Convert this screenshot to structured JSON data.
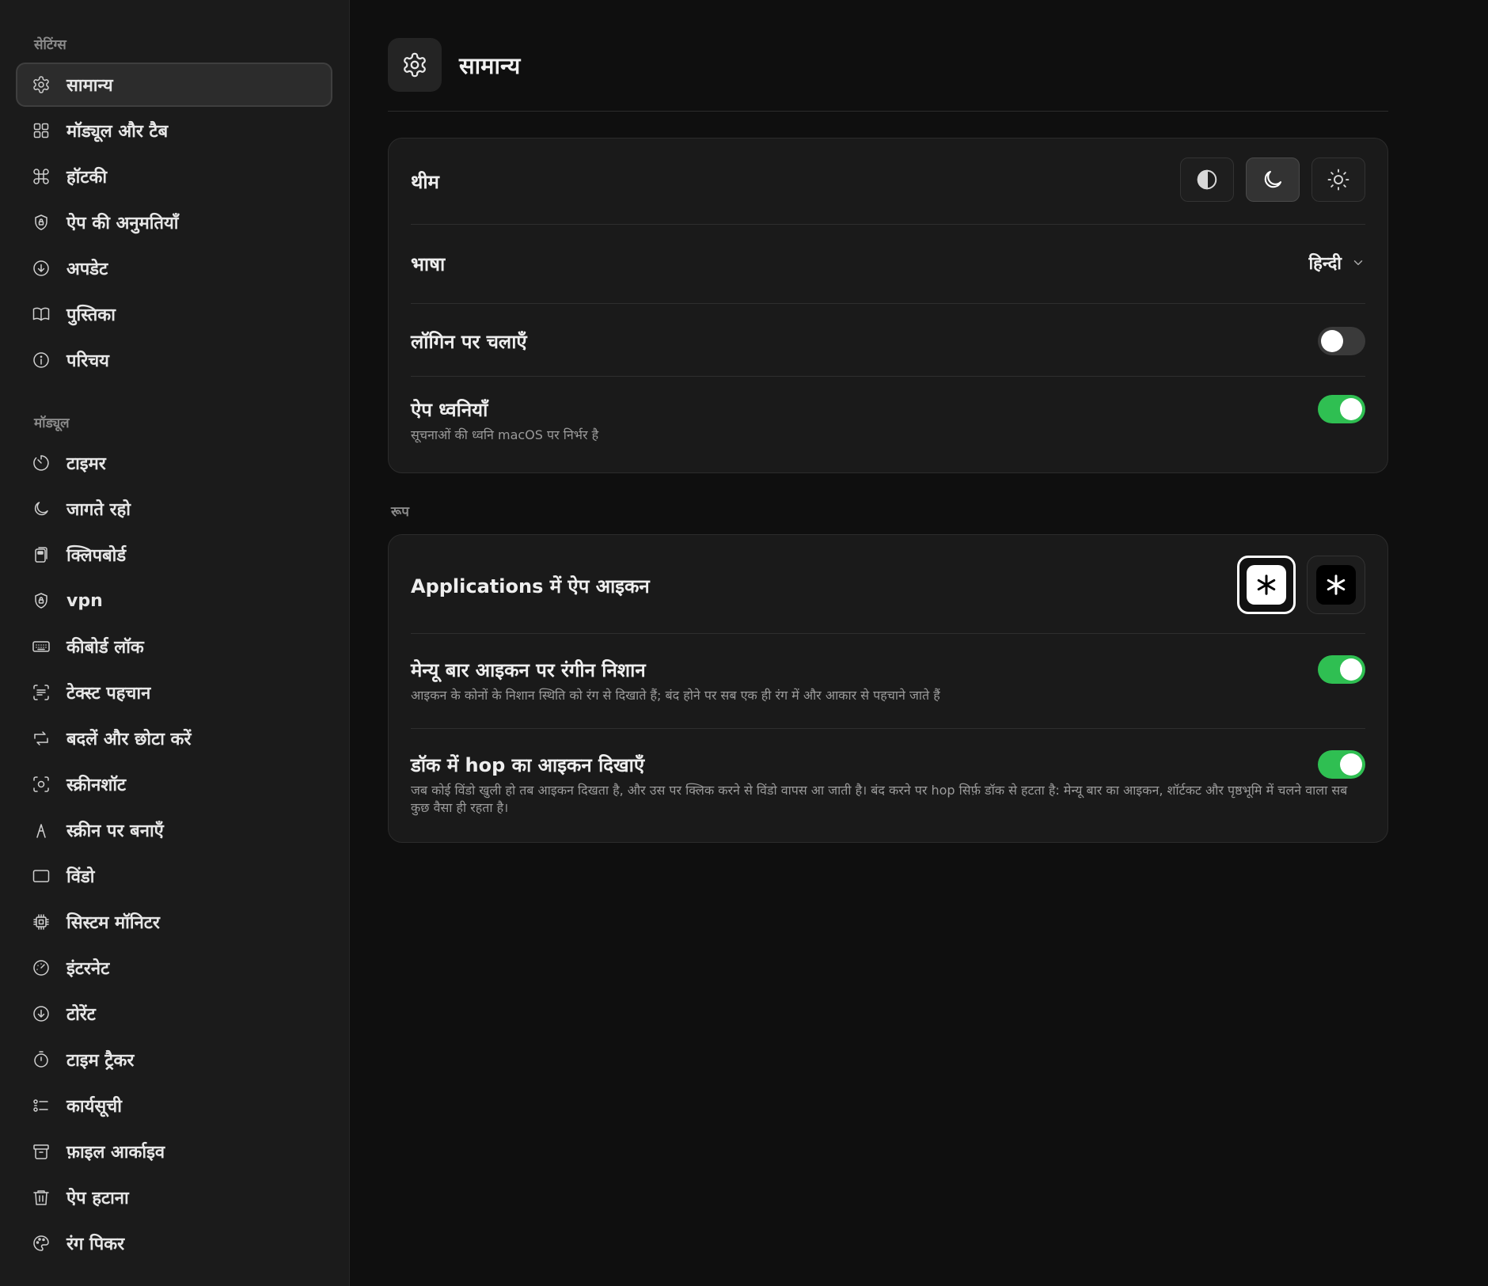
{
  "sidebar": {
    "settings_heading": "सेटिंग्स",
    "settings_items": [
      {
        "label": "सामान्य",
        "icon": "gear-icon",
        "active": true
      },
      {
        "label": "मॉड्यूल और टैब",
        "icon": "grid-icon"
      },
      {
        "label": "हॉटकी",
        "icon": "command-icon"
      },
      {
        "label": "ऐप की अनुमतियाँ",
        "icon": "shield-lock-icon"
      },
      {
        "label": "अपडेट",
        "icon": "download-circle-icon"
      },
      {
        "label": "पुस्तिका",
        "icon": "book-icon"
      },
      {
        "label": "परिचय",
        "icon": "info-icon"
      }
    ],
    "modules_heading": "मॉड्यूल",
    "module_items": [
      {
        "label": "टाइमर",
        "icon": "timer-icon"
      },
      {
        "label": "जागते रहो",
        "icon": "moon-icon"
      },
      {
        "label": "क्लिपबोर्ड",
        "icon": "clipboard-icon"
      },
      {
        "label": "vpn",
        "icon": "shield-lock-icon"
      },
      {
        "label": "कीबोर्ड लॉक",
        "icon": "keyboard-icon"
      },
      {
        "label": "टेक्स्ट पहचान",
        "icon": "text-scan-icon"
      },
      {
        "label": "बदलें और छोटा करें",
        "icon": "convert-icon"
      },
      {
        "label": "स्क्रीनशॉट",
        "icon": "screenshot-icon"
      },
      {
        "label": "स्क्रीन पर बनाएँ",
        "icon": "pen-icon"
      },
      {
        "label": "विंडो",
        "icon": "window-icon"
      },
      {
        "label": "सिस्टम मॉनिटर",
        "icon": "cpu-icon"
      },
      {
        "label": "इंटरनेट",
        "icon": "speedometer-icon"
      },
      {
        "label": "टोरेंट",
        "icon": "download-circle-icon"
      },
      {
        "label": "टाइम ट्रैकर",
        "icon": "stopwatch-icon"
      },
      {
        "label": "कार्यसूची",
        "icon": "checklist-icon"
      },
      {
        "label": "फ़ाइल आर्काइव",
        "icon": "archive-icon"
      },
      {
        "label": "ऐप हटाना",
        "icon": "trash-icon"
      },
      {
        "label": "रंग पिकर",
        "icon": "palette-icon"
      }
    ]
  },
  "header": {
    "title": "सामान्य",
    "icon": "gear-icon"
  },
  "general": {
    "theme_label": "थीम",
    "theme_options": [
      "auto",
      "dark",
      "light"
    ],
    "theme_selected": "dark",
    "language_label": "भाषा",
    "language_value": "हिन्दी",
    "launch_label": "लॉगिन पर चलाएँ",
    "launch_on": false,
    "sounds_label": "ऐप ध्वनियाँ",
    "sounds_desc": "सूचनाओं की ध्वनि macOS पर निर्भर है",
    "sounds_on": true
  },
  "appearance": {
    "section_label": "रूप",
    "app_icon_label": "Applications में ऐप आइकन",
    "app_icon_selected": "light",
    "menubar_label": "मेन्यू बार आइकन पर रंगीन निशान",
    "menubar_desc": "आइकन के कोनों के निशान स्थिति को रंग से दिखाते हैं; बंद होने पर सब एक ही रंग में और आकार से पहचाने जाते हैं",
    "menubar_on": true,
    "dock_label": "डॉक में hop का आइकन दिखाएँ",
    "dock_desc": "जब कोई विंडो खुली हो तब आइकन दिखता है, और उस पर क्लिक करने से विंडो वापस आ जाती है। बंद करने पर hop सिर्फ़ डॉक से हटता है: मेन्यू बार का आइकन, शॉर्टकट और पृष्ठभूमि में चलने वाला सब कुछ वैसा ही रहता है।",
    "dock_on": true
  },
  "colors": {
    "accent_green": "#2fbf52",
    "background": "#0f0f0f",
    "sidebar": "#1b1b1b"
  }
}
